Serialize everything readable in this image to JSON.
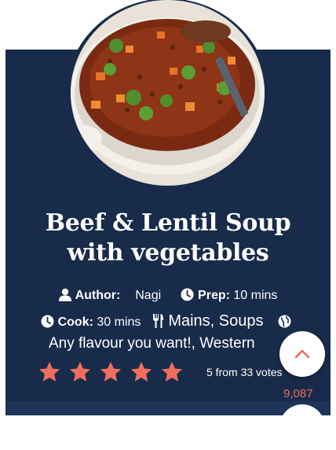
{
  "recipe": {
    "title_line1": "Beef & Lentil Soup",
    "title_line2": "with vegetables",
    "author_label": "Author:",
    "author_name": "Nagi",
    "prep_label": "Prep:",
    "prep_value": "10 mins",
    "cook_label": "Cook:",
    "cook_value": "30 mins",
    "course": "Mains, Soups",
    "cuisine": "Any flavour you want!, Western",
    "rating_text": "5 from 33 votes",
    "rating_value": 5,
    "views": "9,087"
  },
  "colors": {
    "card_bg": "#182b4a",
    "star": "#ef6f5c",
    "accent": "#ef6f5c"
  },
  "icons": [
    "user-icon",
    "clock-icon",
    "utensils-icon",
    "globe-icon",
    "star-icon",
    "chevron-up-icon"
  ]
}
